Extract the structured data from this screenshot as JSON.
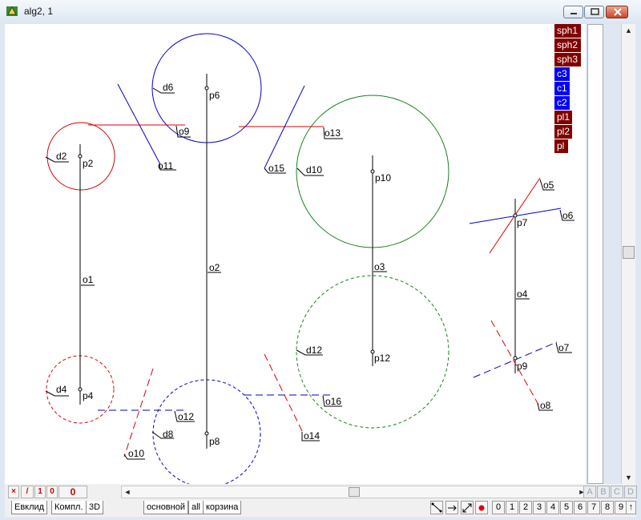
{
  "window": {
    "title": "alg2, 1"
  },
  "legend": [
    {
      "label": "sph1",
      "color": "#800000"
    },
    {
      "label": "sph2",
      "color": "#800000"
    },
    {
      "label": "sph3",
      "color": "#800000"
    },
    {
      "label": "c3",
      "color": "#0000ff"
    },
    {
      "label": "c1",
      "color": "#0000ff"
    },
    {
      "label": "c2",
      "color": "#0000ff"
    },
    {
      "label": "pl1",
      "color": "#800000"
    },
    {
      "label": "pl2",
      "color": "#800000"
    },
    {
      "label": "pl",
      "color": "#800000"
    }
  ],
  "labels": {
    "d6": "d6",
    "p6": "p6",
    "o9": "o9",
    "o13": "o13",
    "d2": "d2",
    "p2": "p2",
    "o11": "o11",
    "o15": "o15",
    "d10": "d10",
    "p10": "p10",
    "o5": "o5",
    "p7": "p7",
    "o6": "o6",
    "o1": "o1",
    "o2": "o2",
    "o3": "o3",
    "o4": "o4",
    "d12": "d12",
    "p12": "p12",
    "o7": "o7",
    "p9": "p9",
    "d4": "d4",
    "p4": "p4",
    "o16": "o16",
    "o12": "o12",
    "o8": "o8",
    "d8": "d8",
    "p8": "p8",
    "o14": "o14",
    "o10": "o10"
  },
  "toolbar": {
    "mini_buttons": [
      "×",
      "/",
      "1",
      "0"
    ],
    "counter": "0",
    "scroll_left": "◄",
    "scroll_right": "►",
    "abcd": [
      "A",
      "B",
      "C",
      "D"
    ],
    "tabs": [
      "Евклид",
      "Компл.",
      "3D",
      "основной",
      "all",
      "корзина"
    ],
    "tool_buttons": [
      "0",
      "1",
      "2",
      "3",
      "4",
      "5",
      "6",
      "7",
      "8",
      "9",
      "↑"
    ],
    "icon_buttons": [
      "diagonal-line-icon",
      "arrow-right-icon",
      "resize-arrow-icon",
      "record-dot-icon"
    ]
  },
  "scroll": {
    "up": "▲",
    "down": "▼"
  }
}
